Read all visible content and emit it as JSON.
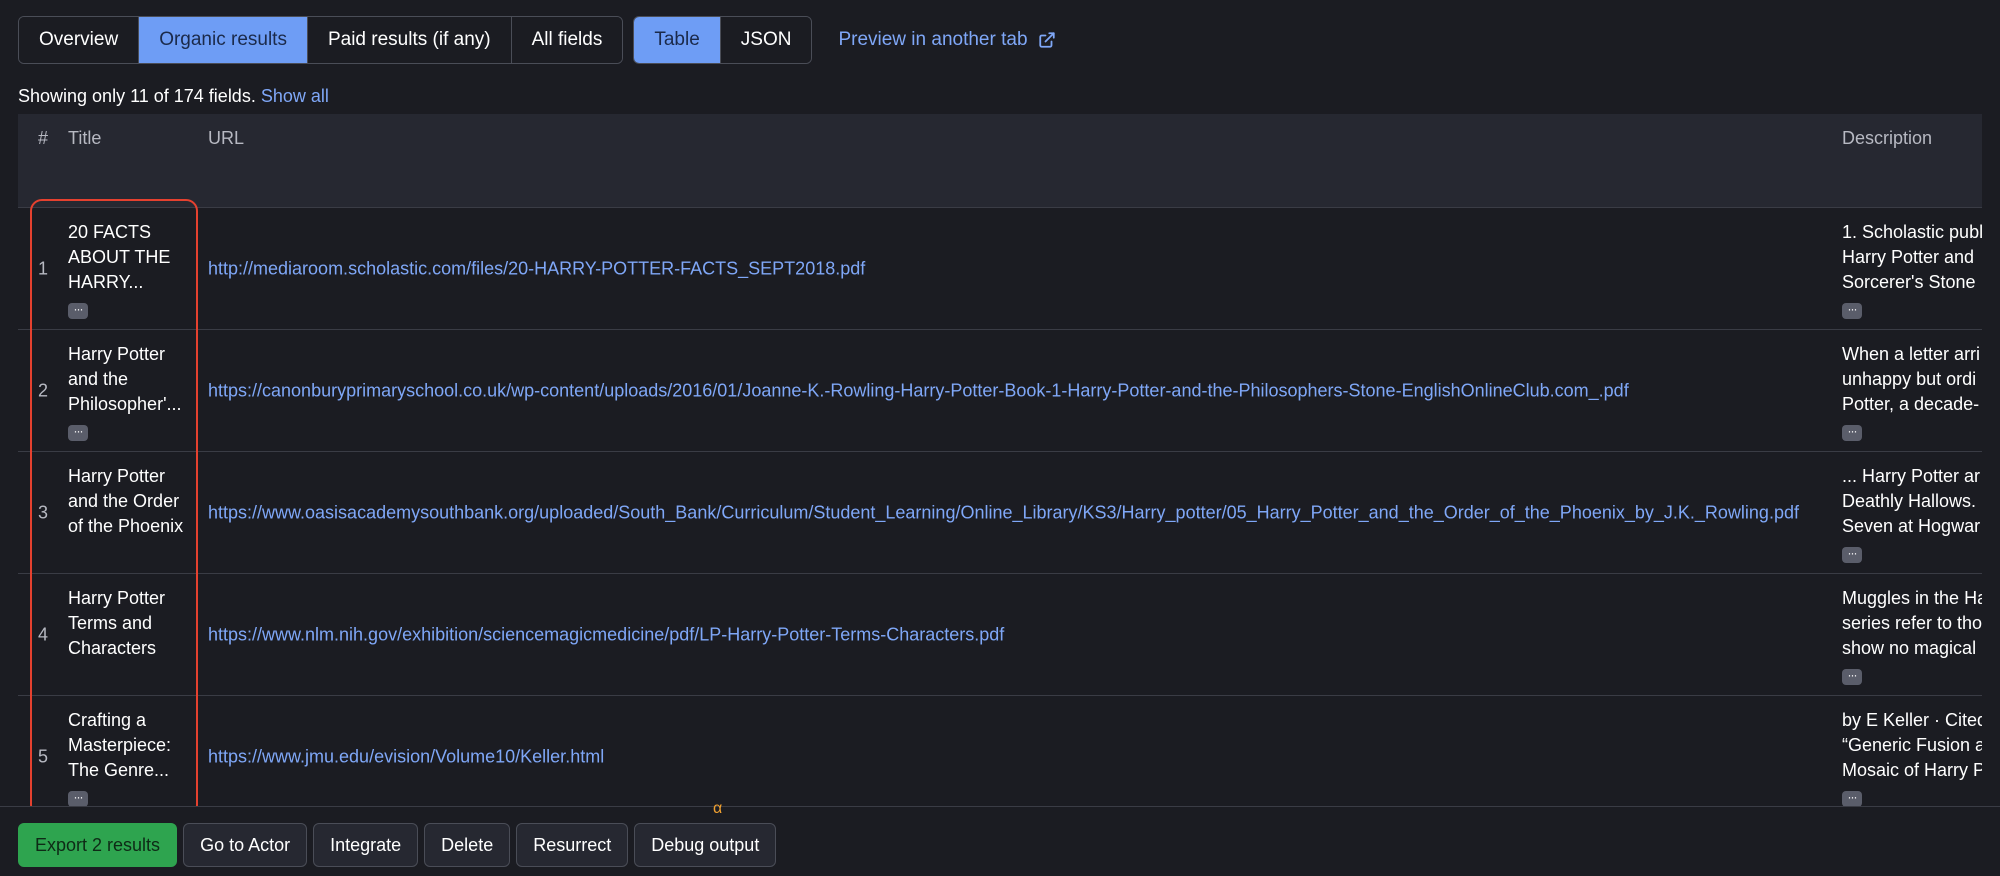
{
  "tabs": {
    "items": [
      {
        "label": "Overview",
        "active": false
      },
      {
        "label": "Organic results",
        "active": true
      },
      {
        "label": "Paid results (if any)",
        "active": false
      },
      {
        "label": "All fields",
        "active": false
      }
    ]
  },
  "view_toggle": {
    "items": [
      {
        "label": "Table",
        "active": true
      },
      {
        "label": "JSON",
        "active": false
      }
    ]
  },
  "preview_link": {
    "label": "Preview in another tab",
    "icon": "external-link-icon"
  },
  "fields_notice": {
    "text": "Showing only 11 of 174 fields.",
    "show_all_label": "Show all"
  },
  "table": {
    "headers": {
      "num": "#",
      "title": "Title",
      "url": "URL",
      "description": "Description"
    },
    "rows": [
      {
        "num": "1",
        "title_lines": [
          "20 FACTS",
          "ABOUT THE",
          "HARRY..."
        ],
        "url": "http://mediaroom.scholastic.com/files/20-HARRY-POTTER-FACTS_SEPT2018.pdf",
        "desc_lines": [
          "1. Scholastic publ",
          "Harry Potter and",
          "Sorcerer's Stone"
        ],
        "title_more": true,
        "desc_more": true
      },
      {
        "num": "2",
        "title_lines": [
          "Harry Potter",
          "and the",
          "Philosopher'..."
        ],
        "url": "https://canonburyprimaryschool.co.uk/wp-content/uploads/2016/01/Joanne-K.-Rowling-Harry-Potter-Book-1-Harry-Potter-and-the-Philosophers-Stone-EnglishOnlineClub.com_.pdf",
        "desc_lines": [
          "When a letter arri",
          "unhappy but ordi",
          "Potter, a decade-"
        ],
        "title_more": true,
        "desc_more": true
      },
      {
        "num": "3",
        "title_lines": [
          "Harry Potter",
          "and the Order",
          "of the Phoenix"
        ],
        "url": "https://www.oasisacademysouthbank.org/uploaded/South_Bank/Curriculum/Student_Learning/Online_Library/KS3/Harry_potter/05_Harry_Potter_and_the_Order_of_the_Phoenix_by_J.K._Rowling.pdf",
        "desc_lines": [
          "... Harry Potter ar",
          "Deathly Hallows.",
          "Seven at Hogwar"
        ],
        "title_more": false,
        "desc_more": true
      },
      {
        "num": "4",
        "title_lines": [
          "Harry Potter",
          "Terms and",
          "Characters"
        ],
        "url": "https://www.nlm.nih.gov/exhibition/sciencemagicmedicine/pdf/LP-Harry-Potter-Terms-Characters.pdf",
        "desc_lines": [
          "Muggles in the Ha",
          "series refer to tho",
          "show no magical"
        ],
        "title_more": false,
        "desc_more": true
      },
      {
        "num": "5",
        "title_lines": [
          "Crafting a",
          "Masterpiece:",
          "The Genre..."
        ],
        "url": "https://www.jmu.edu/evision/Volume10/Keller.html",
        "desc_lines": [
          "by E Keller · Cited",
          "“Generic Fusion a",
          "Mosaic of Harry P"
        ],
        "title_more": true,
        "desc_more": true
      }
    ]
  },
  "alpha_marker": "α",
  "actions": {
    "export": "Export 2 results",
    "go_to_actor": "Go to Actor",
    "integrate": "Integrate",
    "delete": "Delete",
    "resurrect": "Resurrect",
    "debug_output": "Debug output"
  },
  "colors": {
    "background": "#1b1c22",
    "accent": "#6e9df5",
    "link": "#7fa7f7",
    "highlight": "#e5412f",
    "export": "#2ea44f"
  }
}
